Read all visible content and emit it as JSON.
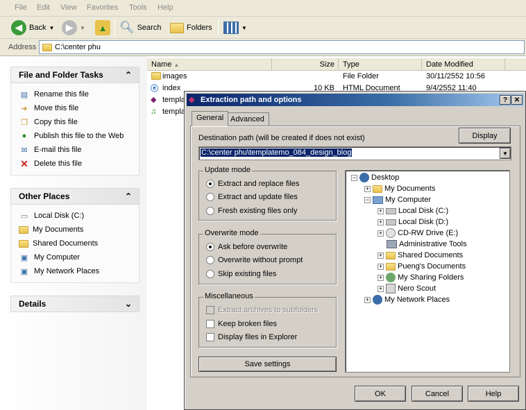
{
  "menu": [
    "File",
    "Edit",
    "View",
    "Favorites",
    "Tools",
    "Help"
  ],
  "toolbar": {
    "back": "Back",
    "search": "Search",
    "folders": "Folders"
  },
  "address": {
    "label": "Address",
    "value": "C:\\center phu"
  },
  "tasks": {
    "file_folder": {
      "title": "File and Folder Tasks",
      "items": [
        "Rename this file",
        "Move this file",
        "Copy this file",
        "Publish this file to the Web",
        "E-mail this file",
        "Delete this file"
      ]
    },
    "other_places": {
      "title": "Other Places",
      "items": [
        "Local Disk (C:)",
        "My Documents",
        "Shared Documents",
        "My Computer",
        "My Network Places"
      ]
    },
    "details": {
      "title": "Details"
    }
  },
  "filelist": {
    "columns": [
      "Name",
      "Size",
      "Type",
      "Date Modified"
    ],
    "rows": [
      {
        "name": "images",
        "size": "",
        "type": "File Folder",
        "date": "30/11/2552 10:56"
      },
      {
        "name": "index",
        "size": "10 KB",
        "type": "HTML Document",
        "date": "9/4/2552 11:40"
      },
      {
        "name": "templa",
        "size": "",
        "type": "",
        "date": ""
      },
      {
        "name": "templa",
        "size": "",
        "type": "",
        "date": ""
      }
    ]
  },
  "dialog": {
    "title": "Extraction path and options",
    "help_btn": "?",
    "close_btn": "✕",
    "tabs": [
      "General",
      "Advanced"
    ],
    "dest_label": "Destination path (will be created if does not exist)",
    "display_btn": "Display",
    "dest_value": "C:\\center phu\\templatemo_084_design_blog",
    "update_mode": {
      "title": "Update mode",
      "options": [
        "Extract and replace files",
        "Extract and update files",
        "Fresh existing files only"
      ],
      "selected": 0
    },
    "overwrite_mode": {
      "title": "Overwrite mode",
      "options": [
        "Ask before overwrite",
        "Overwrite without prompt",
        "Skip existing files"
      ],
      "selected": 0
    },
    "misc": {
      "title": "Miscellaneous",
      "options": [
        "Extract archives to subfolders",
        "Keep broken files",
        "Display files in Explorer"
      ]
    },
    "save_btn": "Save settings",
    "tree": [
      "Desktop",
      "My Documents",
      "My Computer",
      "Local Disk (C:)",
      "Local Disk (D:)",
      "CD-RW Drive (E:)",
      "Administrative Tools",
      "Shared Documents",
      "Pueng's Documents",
      "My Sharing Folders",
      "Nero Scout",
      "My Network Places"
    ],
    "ok": "OK",
    "cancel": "Cancel",
    "help": "Help"
  },
  "colors": {
    "title_bar": "#0a246a",
    "selection": "#0a246a",
    "dialog_face": "#d4d0c8"
  }
}
